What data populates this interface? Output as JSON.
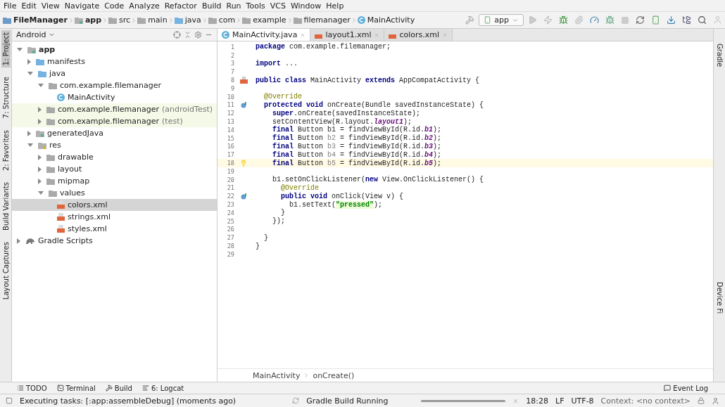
{
  "menu": [
    "File",
    "Edit",
    "View",
    "Navigate",
    "Code",
    "Analyze",
    "Refactor",
    "Build",
    "Run",
    "Tools",
    "VCS",
    "Window",
    "Help"
  ],
  "breadcrumbs": [
    {
      "label": "FileManager",
      "kind": "project"
    },
    {
      "label": "app",
      "kind": "module"
    },
    {
      "label": "src",
      "kind": "folder"
    },
    {
      "label": "main",
      "kind": "folder"
    },
    {
      "label": "java",
      "kind": "source"
    },
    {
      "label": "com",
      "kind": "folder"
    },
    {
      "label": "example",
      "kind": "folder"
    },
    {
      "label": "filemanager",
      "kind": "folder"
    },
    {
      "label": "MainActivity",
      "kind": "class"
    }
  ],
  "run_config": "app",
  "left_strip": [
    {
      "label": "1: Project",
      "selected": true
    },
    {
      "label": "7: Structure",
      "selected": false
    },
    {
      "label": "2: Favorites",
      "selected": false
    },
    {
      "label": "Build Variants",
      "selected": false
    },
    {
      "label": "Layout Captures",
      "selected": false
    }
  ],
  "right_strip": [
    {
      "label": "Gradle",
      "selected": false
    },
    {
      "label": "Device Fi",
      "selected": false
    }
  ],
  "project_view": {
    "mode": "Android",
    "tree": [
      {
        "label": "app",
        "kind": "module",
        "expanded": true,
        "selected": false,
        "test": false,
        "children": [
          {
            "label": "manifests",
            "kind": "source",
            "expanded": false,
            "selected": false,
            "test": false
          },
          {
            "label": "java",
            "kind": "source",
            "expanded": true,
            "selected": false,
            "test": false,
            "children": [
              {
                "label": "com.example.filemanager",
                "kind": "folder",
                "expanded": true,
                "selected": false,
                "test": false,
                "children": [
                  {
                    "label": "MainActivity",
                    "kind": "class",
                    "selected": false,
                    "test": false
                  }
                ]
              },
              {
                "label": "com.example.filemanager",
                "suffix": "(androidTest)",
                "kind": "folder",
                "expanded": false,
                "selected": false,
                "test": true
              },
              {
                "label": "com.example.filemanager",
                "suffix": "(test)",
                "kind": "folder",
                "expanded": false,
                "selected": false,
                "test": true
              }
            ]
          },
          {
            "label": "generatedJava",
            "kind": "generated",
            "expanded": false,
            "selected": false,
            "test": false
          },
          {
            "label": "res",
            "kind": "resource",
            "expanded": true,
            "selected": false,
            "test": false,
            "children": [
              {
                "label": "drawable",
                "kind": "folder",
                "expanded": false,
                "selected": false,
                "test": false
              },
              {
                "label": "layout",
                "kind": "folder",
                "expanded": false,
                "selected": false,
                "test": false
              },
              {
                "label": "mipmap",
                "kind": "folder",
                "expanded": false,
                "selected": false,
                "test": false
              },
              {
                "label": "values",
                "kind": "folder",
                "expanded": true,
                "selected": false,
                "test": false,
                "children": [
                  {
                    "label": "colors.xml",
                    "kind": "xml",
                    "selected": true,
                    "test": false
                  },
                  {
                    "label": "strings.xml",
                    "kind": "xml",
                    "selected": false,
                    "test": false
                  },
                  {
                    "label": "styles.xml",
                    "kind": "xml",
                    "selected": false,
                    "test": false
                  }
                ]
              }
            ]
          }
        ]
      },
      {
        "label": "Gradle Scripts",
        "kind": "gradle",
        "expanded": false,
        "selected": false,
        "test": false
      }
    ]
  },
  "editor_tabs": [
    {
      "label": "MainActivity.java",
      "kind": "class",
      "selected": true
    },
    {
      "label": "layout1.xml",
      "kind": "xml",
      "selected": false
    },
    {
      "label": "colors.xml",
      "kind": "xml",
      "selected": false
    }
  ],
  "code": [
    {
      "n": "1",
      "current": false,
      "tokens": [
        {
          "kind": "kw",
          "text": "package "
        },
        {
          "kind": "plain",
          "text": "com.example.filemanager;"
        }
      ]
    },
    {
      "n": "2",
      "current": false
    },
    {
      "n": "3",
      "current": false,
      "tokens": [
        {
          "kind": "kw",
          "text": "import "
        },
        {
          "kind": "plain",
          "text": "..."
        }
      ]
    },
    {
      "n": "7",
      "current": false
    },
    {
      "n": "8",
      "current": false,
      "tokens": [
        {
          "kind": "kw",
          "text": "public class "
        },
        {
          "kind": "plain",
          "text": "MainActivity "
        },
        {
          "kind": "kw",
          "text": "extends "
        },
        {
          "kind": "plain",
          "text": "AppCompatActivity {"
        }
      ]
    },
    {
      "n": "9",
      "current": false
    },
    {
      "n": "10",
      "current": false,
      "tokens": [
        {
          "kind": "annot",
          "text": "  @Override"
        }
      ]
    },
    {
      "n": "11",
      "current": false,
      "tokens": [
        {
          "kind": "kw",
          "text": "  protected void "
        },
        {
          "kind": "plain",
          "text": "onCreate(Bundle savedInstanceState) {"
        }
      ]
    },
    {
      "n": "12",
      "current": false,
      "tokens": [
        {
          "kind": "kw",
          "text": "    super"
        },
        {
          "kind": "plain",
          "text": ".onCreate(savedInstanceState);"
        }
      ]
    },
    {
      "n": "13",
      "current": false,
      "tokens": [
        {
          "kind": "plain",
          "text": "    setContentView(R.layout."
        },
        {
          "kind": "field",
          "text": "layout1"
        },
        {
          "kind": "plain",
          "text": ");"
        }
      ]
    },
    {
      "n": "14",
      "current": false,
      "tokens": [
        {
          "kind": "kw",
          "text": "    final "
        },
        {
          "kind": "plain",
          "text": "Button b1 = findViewById(R.id."
        },
        {
          "kind": "field",
          "text": "b1"
        },
        {
          "kind": "plain",
          "text": ");"
        }
      ]
    },
    {
      "n": "15",
      "current": false,
      "tokens": [
        {
          "kind": "kw",
          "text": "    final "
        },
        {
          "kind": "plain",
          "text": "Button "
        },
        {
          "kind": "unused",
          "text": "b2"
        },
        {
          "kind": "plain",
          "text": " = findViewById(R.id."
        },
        {
          "kind": "field",
          "text": "b2"
        },
        {
          "kind": "plain",
          "text": ");"
        }
      ]
    },
    {
      "n": "16",
      "current": false,
      "tokens": [
        {
          "kind": "kw",
          "text": "    final "
        },
        {
          "kind": "plain",
          "text": "Button "
        },
        {
          "kind": "unused",
          "text": "b3"
        },
        {
          "kind": "plain",
          "text": " = findViewById(R.id."
        },
        {
          "kind": "field",
          "text": "b3"
        },
        {
          "kind": "plain",
          "text": ");"
        }
      ]
    },
    {
      "n": "17",
      "current": false,
      "tokens": [
        {
          "kind": "kw",
          "text": "    final "
        },
        {
          "kind": "plain",
          "text": "Button "
        },
        {
          "kind": "unused",
          "text": "b4"
        },
        {
          "kind": "plain",
          "text": " = findViewById(R.id."
        },
        {
          "kind": "field",
          "text": "b4"
        },
        {
          "kind": "plain",
          "text": ");"
        }
      ]
    },
    {
      "n": "18",
      "current": true,
      "tokens": [
        {
          "kind": "kw",
          "text": "    final "
        },
        {
          "kind": "plain",
          "text": "Button "
        },
        {
          "kind": "unused",
          "text": "b5"
        },
        {
          "kind": "plain",
          "text": " = findViewById(R.id."
        },
        {
          "kind": "field",
          "text": "b5"
        },
        {
          "kind": "plain",
          "text": ");"
        }
      ]
    },
    {
      "n": "19",
      "current": false
    },
    {
      "n": "20",
      "current": false,
      "tokens": [
        {
          "kind": "plain",
          "text": "    b1.setOnClickListener("
        },
        {
          "kind": "kw",
          "text": "new "
        },
        {
          "kind": "plain",
          "text": "View.OnClickListener() {"
        }
      ]
    },
    {
      "n": "21",
      "current": false,
      "tokens": [
        {
          "kind": "annot",
          "text": "      @Override"
        }
      ]
    },
    {
      "n": "22",
      "current": false,
      "tokens": [
        {
          "kind": "kw",
          "text": "      public void "
        },
        {
          "kind": "plain",
          "text": "onClick(View v) {"
        }
      ]
    },
    {
      "n": "23",
      "current": false,
      "tokens": [
        {
          "kind": "plain",
          "text": "        b1.setText("
        },
        {
          "kind": "str",
          "text": "\"pressed\""
        },
        {
          "kind": "plain",
          "text": ");"
        }
      ]
    },
    {
      "n": "24",
      "current": false,
      "tokens": [
        {
          "kind": "plain",
          "text": "      }"
        }
      ]
    },
    {
      "n": "25",
      "current": false,
      "tokens": [
        {
          "kind": "plain",
          "text": "    });"
        }
      ]
    },
    {
      "n": "26",
      "current": false
    },
    {
      "n": "27",
      "current": false,
      "tokens": [
        {
          "kind": "plain",
          "text": "  }"
        }
      ]
    },
    {
      "n": "28",
      "current": false,
      "tokens": [
        {
          "kind": "plain",
          "text": "}"
        }
      ]
    },
    {
      "n": "29",
      "current": false
    }
  ],
  "editor_breadcrumbs": [
    "MainActivity",
    "onCreate()"
  ],
  "tool_tabs": [
    "TODO",
    "Terminal",
    "Build",
    "6: Logcat"
  ],
  "event_log": "Event Log",
  "status": {
    "message": "Executing tasks: [:app:assembleDebug] (moments ago)",
    "task": "Gradle Build Running",
    "level": 1,
    "position": "18:28",
    "line_sep": "LF",
    "encoding": "UTF-8",
    "context": "Context: <no context>"
  }
}
